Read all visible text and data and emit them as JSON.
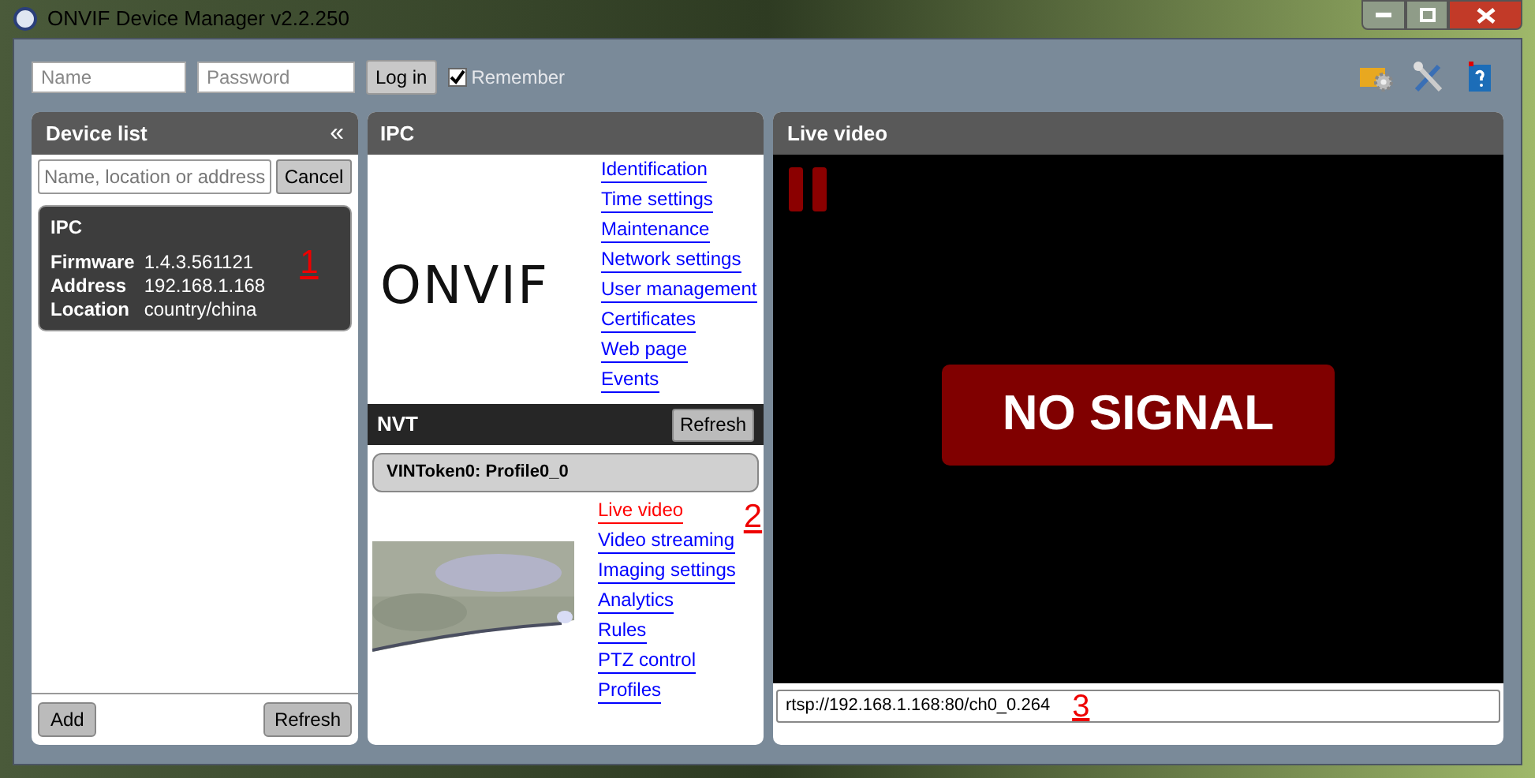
{
  "window": {
    "title": "ONVIF Device Manager v2.2.250"
  },
  "login": {
    "name_placeholder": "Name",
    "password_placeholder": "Password",
    "button": "Log in",
    "remember": {
      "label": "Remember",
      "checked": true
    }
  },
  "device_list": {
    "title": "Device list",
    "collapse": "«",
    "search_placeholder": "Name, location or address",
    "cancel": "Cancel",
    "devices": [
      {
        "name": "IPC",
        "selected": true,
        "fields": [
          {
            "label": "Firmware",
            "value": "1.4.3.561121"
          },
          {
            "label": "Address",
            "value": "192.168.1.168"
          },
          {
            "label": "Location",
            "value": "country/china"
          }
        ]
      }
    ],
    "buttons": [
      "Add",
      "Refresh"
    ]
  },
  "ipc": {
    "title": "IPC",
    "logo": "ONVIF",
    "links": [
      {
        "label": "Identification",
        "selected": false
      },
      {
        "label": "Time settings",
        "selected": false
      },
      {
        "label": "Maintenance",
        "selected": false
      },
      {
        "label": "Network settings",
        "selected": false
      },
      {
        "label": "User management",
        "selected": false
      },
      {
        "label": "Certificates",
        "selected": false
      },
      {
        "label": "Web page",
        "selected": false
      },
      {
        "label": "Events",
        "selected": false
      }
    ]
  },
  "nvt": {
    "title": "NVT",
    "refresh": "Refresh",
    "profile": "VINToken0: Profile0_0",
    "links": [
      {
        "label": "Live video",
        "selected": true
      },
      {
        "label": "Video streaming",
        "selected": false
      },
      {
        "label": "Imaging settings",
        "selected": false
      },
      {
        "label": "Analytics",
        "selected": false
      },
      {
        "label": "Rules",
        "selected": false
      },
      {
        "label": "PTZ control",
        "selected": false
      },
      {
        "label": "Profiles",
        "selected": false
      }
    ]
  },
  "live_video": {
    "title": "Live video",
    "status": "NO SIGNAL",
    "url": "rtsp://192.168.1.168:80/ch0_0.264"
  },
  "annotations": [
    "1",
    "2",
    "3"
  ]
}
